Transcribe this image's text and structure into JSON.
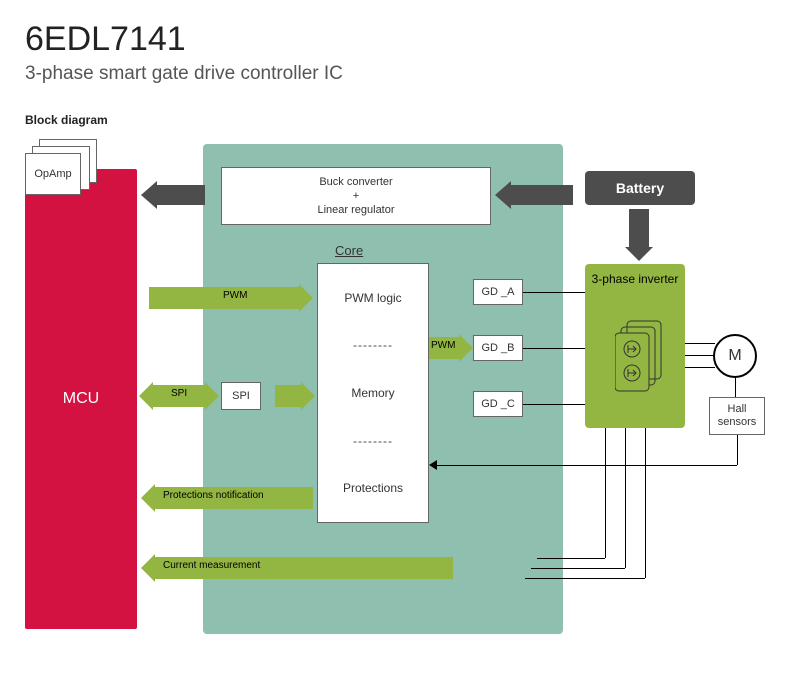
{
  "title": "6EDL7141",
  "subtitle": "3-phase smart gate drive controller IC",
  "section": "Block diagram",
  "ic_label": "6EDL7141",
  "blocks": {
    "mcu": "MCU",
    "buck_line1": "Buck converter",
    "buck_line2": "+",
    "buck_line3": "Linear regulator",
    "core_label": "Core",
    "core_pwm": "PWM logic",
    "core_mem": "Memory",
    "core_prot": "Protections",
    "spi": "SPI",
    "gd_a": "GD _A",
    "gd_b": "GD _B",
    "gd_c": "GD _C",
    "battery": "Battery",
    "inverter": "3-phase inverter",
    "motor": "M",
    "hall": "Hall sensors",
    "opamp": "OpAmp"
  },
  "labels": {
    "pwm_in": "PWM",
    "spi_bus": "SPI",
    "pwm_out": "PWM",
    "prot_notif": "Protections notification",
    "curr_meas": "Current measurement"
  }
}
